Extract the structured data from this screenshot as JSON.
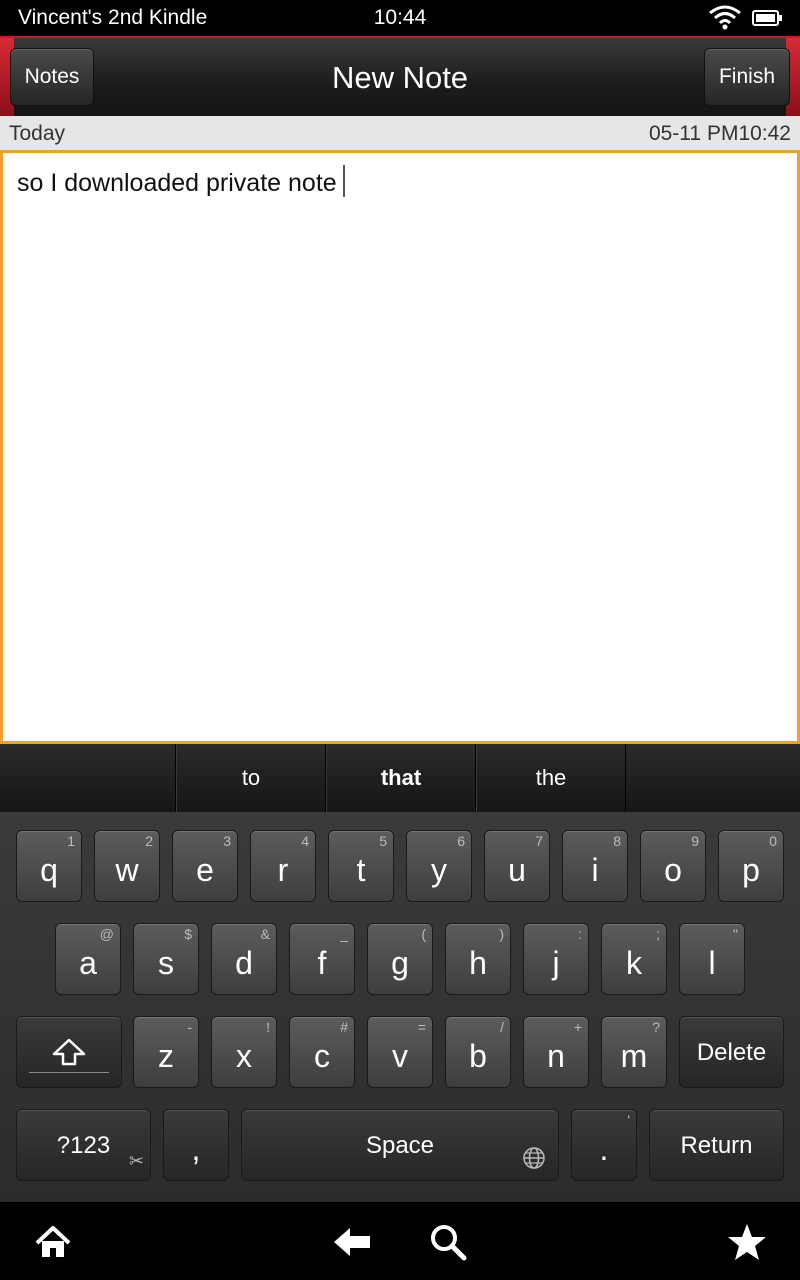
{
  "status_bar": {
    "device_name": "Vincent's 2nd Kindle",
    "time": "10:44",
    "wifi_icon": "wifi-icon",
    "battery_icon": "battery-icon"
  },
  "header": {
    "back_label": "Notes",
    "title": "New Note",
    "finish_label": "Finish",
    "accent_color": "#c21a2a"
  },
  "date_row": {
    "day": "Today",
    "timestamp": "05-11 PM10:42"
  },
  "note": {
    "text": "so I downloaded private note",
    "border_color": "#f0a030"
  },
  "suggestions": [
    "to",
    "that",
    "the"
  ],
  "keyboard": {
    "row1": [
      {
        "key": "q",
        "alt": "1"
      },
      {
        "key": "w",
        "alt": "2"
      },
      {
        "key": "e",
        "alt": "3"
      },
      {
        "key": "r",
        "alt": "4"
      },
      {
        "key": "t",
        "alt": "5"
      },
      {
        "key": "y",
        "alt": "6"
      },
      {
        "key": "u",
        "alt": "7"
      },
      {
        "key": "i",
        "alt": "8"
      },
      {
        "key": "o",
        "alt": "9"
      },
      {
        "key": "p",
        "alt": "0"
      }
    ],
    "row2": [
      {
        "key": "a",
        "alt": "@"
      },
      {
        "key": "s",
        "alt": "$"
      },
      {
        "key": "d",
        "alt": "&"
      },
      {
        "key": "f",
        "alt": "_"
      },
      {
        "key": "g",
        "alt": "("
      },
      {
        "key": "h",
        "alt": ")"
      },
      {
        "key": "j",
        "alt": ":"
      },
      {
        "key": "k",
        "alt": ";"
      },
      {
        "key": "l",
        "alt": "\""
      }
    ],
    "row3": [
      {
        "key": "z",
        "alt": "-"
      },
      {
        "key": "x",
        "alt": "!"
      },
      {
        "key": "c",
        "alt": "#"
      },
      {
        "key": "v",
        "alt": "="
      },
      {
        "key": "b",
        "alt": "/"
      },
      {
        "key": "n",
        "alt": "+"
      },
      {
        "key": "m",
        "alt": "?"
      }
    ],
    "delete_label": "Delete",
    "symbols_label": "?123",
    "comma": ",",
    "space_label": "Space",
    "period": ".",
    "period_alt": "'",
    "return_label": "Return"
  },
  "nav_bar": {
    "icons": [
      "home-icon",
      "back-arrow-icon",
      "search-icon",
      "favorites-star-icon"
    ]
  }
}
